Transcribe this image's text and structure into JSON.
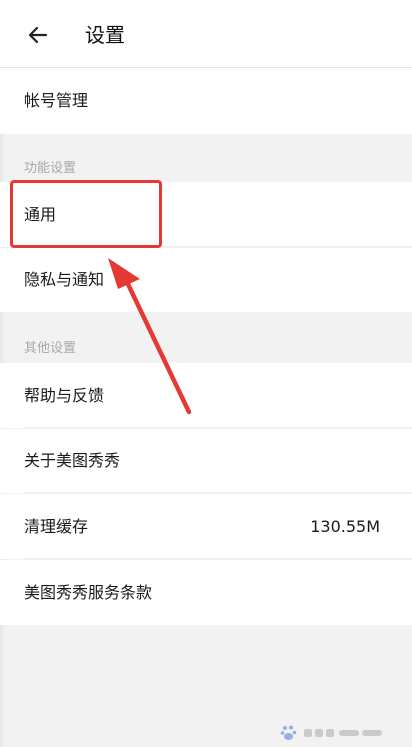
{
  "header": {
    "title": "设置",
    "back_icon": "arrow-left-icon"
  },
  "rows": {
    "account": {
      "label": "帐号管理"
    },
    "general": {
      "label": "通用"
    },
    "privacy": {
      "label": "隐私与通知"
    },
    "help": {
      "label": "帮助与反馈"
    },
    "about": {
      "label": "关于美图秀秀"
    },
    "cache": {
      "label": "清理缓存",
      "value": "130.55M"
    },
    "terms": {
      "label": "美图秀秀服务条款"
    }
  },
  "sections": {
    "features": "功能设置",
    "others": "其他设置"
  },
  "annotations": {
    "highlight_color": "#e53935",
    "pointer": "red-arrow-pointing-to-general"
  },
  "watermark": {
    "icon": "baidu-paw-icon"
  }
}
